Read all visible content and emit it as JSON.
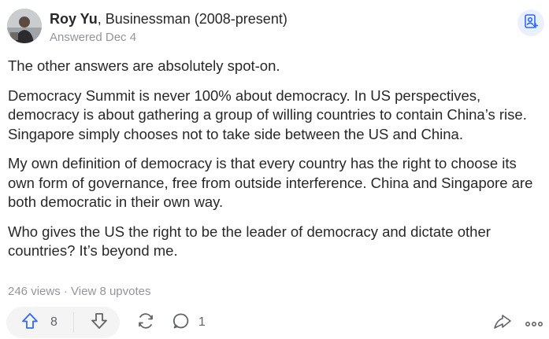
{
  "author": {
    "name": "Roy Yu",
    "credential": ", Businessman (2008-present)",
    "answered": "Answered Dec 4"
  },
  "paragraphs": [
    "The other answers are absolutely spot-on.",
    "Democracy Summit is never 100% about democracy. In US perspectives, democracy is about gathering a group of willing countries to contain China’s rise. Singapore simply chooses not to take side between the US and China.",
    "My own definition of democracy is that every country has the right to choose its own form of governance, free from outside interference. China and Singapore are both democratic in their own way.",
    "Who gives the US the right to be the leader of democracy and dictate other countries? It’s beyond me."
  ],
  "stats": {
    "views": "246 views",
    "separator": " · ",
    "upvotes_link": "View 8 upvotes"
  },
  "actions": {
    "upvote_count": "8",
    "comment_count": "1"
  },
  "colors": {
    "text": "#282829",
    "muted": "#939598",
    "accent": "#2e69ff",
    "pill_bg": "#f4f4f5"
  },
  "icons": [
    "follow-icon",
    "upvote-icon",
    "downvote-icon",
    "share-icon",
    "comment-icon",
    "forward-icon",
    "more-icon"
  ]
}
